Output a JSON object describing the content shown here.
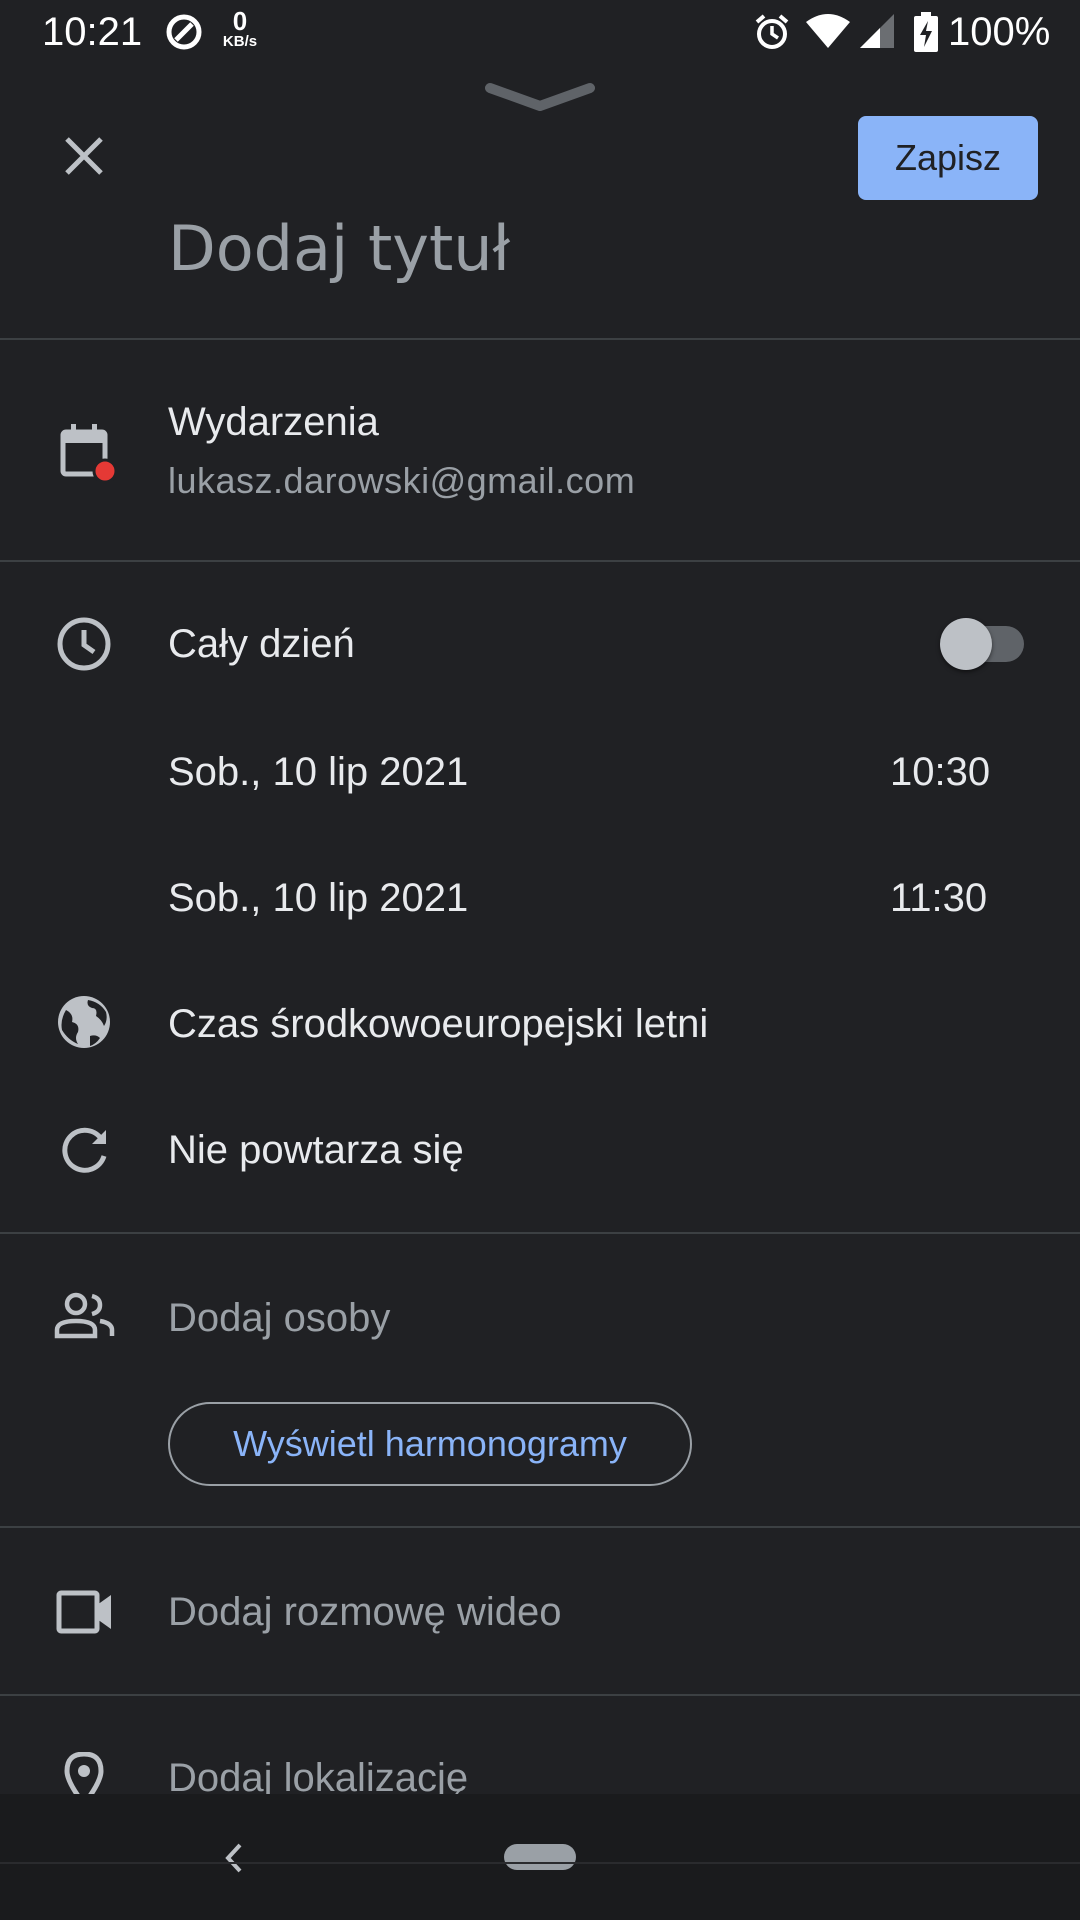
{
  "status_bar": {
    "time": "10:21",
    "speed_value": "0",
    "speed_unit": "KB/s",
    "battery": "100%",
    "icons": [
      "data-saver-icon",
      "alarm-icon",
      "wifi-icon",
      "signal-icon",
      "battery-charging-icon"
    ]
  },
  "header": {
    "close_icon": "close-icon",
    "save_label": "Zapisz",
    "title_placeholder": "Dodaj tytuł"
  },
  "calendar": {
    "name": "Wydarzenia",
    "account": "lukasz.darowski@gmail.com",
    "color": "#e53935"
  },
  "time_section": {
    "all_day_label": "Cały dzień",
    "all_day_on": false,
    "start_date": "Sob., 10 lip 2021",
    "start_time": "10:30",
    "end_date": "Sob., 10 lip 2021",
    "end_time": "11:30",
    "timezone": "Czas środkowoeuropejski letni",
    "repeat": "Nie powtarza się"
  },
  "people": {
    "placeholder": "Dodaj osoby",
    "schedules_button": "Wyświetl harmonogramy"
  },
  "video": {
    "placeholder": "Dodaj rozmowę wideo"
  },
  "location": {
    "placeholder": "Dodaj lokalizację"
  },
  "colors": {
    "background": "#202124",
    "accent": "#8ab4f8",
    "divider": "#3c4043"
  }
}
